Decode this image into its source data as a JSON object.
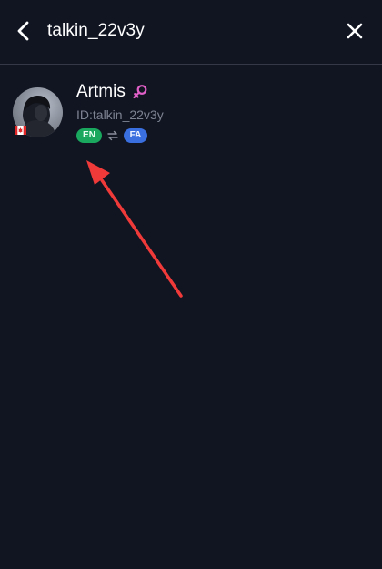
{
  "header": {
    "back_icon": "chevron-left-icon",
    "search_query": "talkin_22v3y",
    "close_icon": "close-icon"
  },
  "result": {
    "display_name": "Artmis",
    "gender_icon": "female-icon",
    "gender_color": "#e060c8",
    "user_id": "ID:talkin_22v3y",
    "country_flag": "canada-flag-icon",
    "native_language": "EN",
    "learning_language": "FA",
    "native_color": "#1aa85f",
    "learning_color": "#3a6fe0",
    "swap_icon": "swap-arrows-icon"
  },
  "annotation": {
    "color": "#f03a3a"
  }
}
